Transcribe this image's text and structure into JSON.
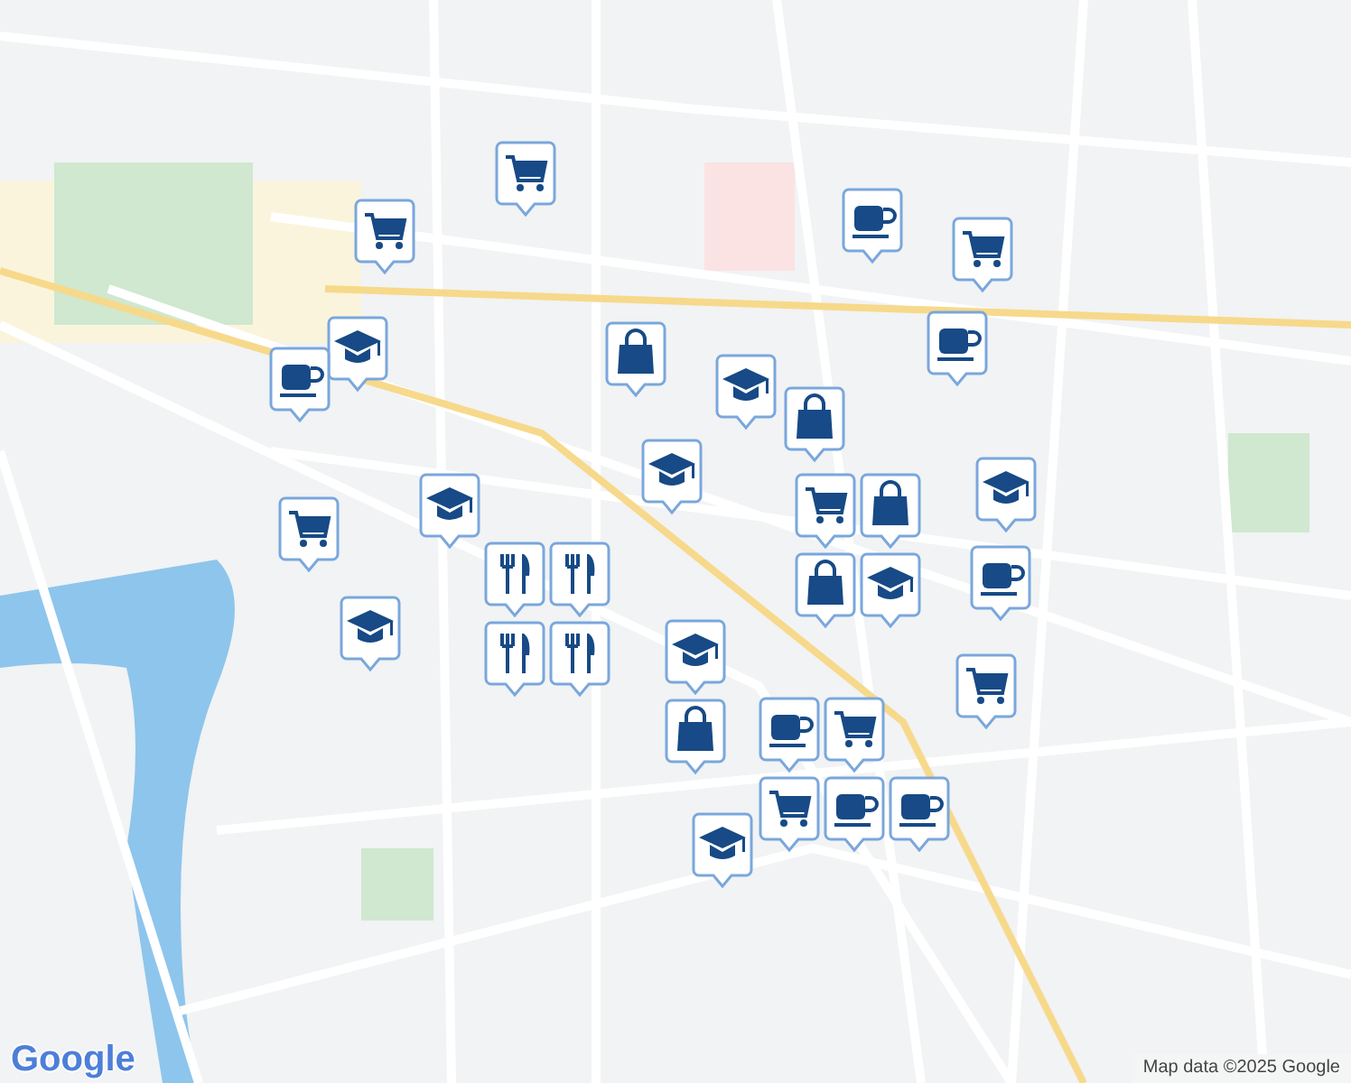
{
  "map": {
    "markers": [
      {
        "kind": "cart"
      },
      {
        "kind": "cart"
      },
      {
        "kind": "coffee"
      },
      {
        "kind": "cart"
      },
      {
        "kind": "school"
      },
      {
        "kind": "coffee"
      },
      {
        "kind": "bag"
      },
      {
        "kind": "school"
      },
      {
        "kind": "bag"
      },
      {
        "kind": "coffee"
      },
      {
        "kind": "school"
      },
      {
        "kind": "school"
      },
      {
        "kind": "cart"
      },
      {
        "kind": "school"
      },
      {
        "kind": "coffee"
      },
      {
        "kind": "restaurant"
      },
      {
        "kind": "restaurant"
      },
      {
        "kind": "restaurant"
      },
      {
        "kind": "restaurant"
      },
      {
        "kind": "cart"
      },
      {
        "kind": "bag"
      },
      {
        "kind": "school"
      },
      {
        "kind": "bag"
      },
      {
        "kind": "school"
      },
      {
        "kind": "school"
      },
      {
        "kind": "bag"
      },
      {
        "kind": "cart"
      },
      {
        "kind": "coffee"
      },
      {
        "kind": "cart"
      },
      {
        "kind": "cart"
      },
      {
        "kind": "coffee"
      },
      {
        "kind": "coffee"
      },
      {
        "kind": "school"
      }
    ]
  },
  "logo": "Google",
  "attribution": "Map data ©2025 Google"
}
